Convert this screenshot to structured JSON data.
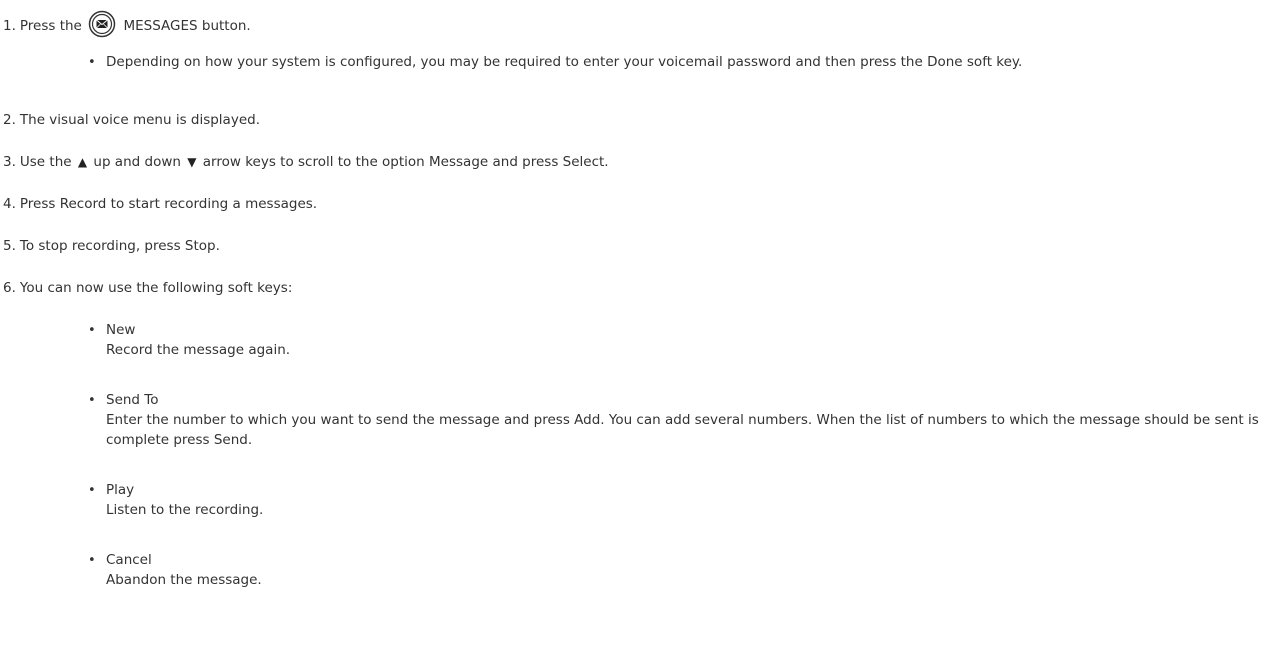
{
  "steps": [
    {
      "num": "1.",
      "before": "Press the",
      "after": "MESSAGES button."
    },
    {
      "num": "2.",
      "text": "The visual voice menu is displayed."
    },
    {
      "num": "3.",
      "before": "Use the",
      "mid": "up and down",
      "after": "arrow keys to scroll to the option Message and press Select."
    },
    {
      "num": "4.",
      "text": "Press Record to start recording a messages."
    },
    {
      "num": "5.",
      "text": "To stop recording, press Stop."
    },
    {
      "num": "6.",
      "text": "You can now use the following soft keys:"
    }
  ],
  "step1_note": "Depending on how your system is configured, you may be required to enter your voicemail password and then press the Done soft key.",
  "softkeys": [
    {
      "term": "New",
      "desc": "Record the message again."
    },
    {
      "term": "Send To",
      "desc": "Enter the number to which you want to send the message and press Add. You can add several numbers. When the list of numbers to which the message should be sent is complete press Send."
    },
    {
      "term": "Play",
      "desc": "Listen to the recording."
    },
    {
      "term": "Cancel",
      "desc": "Abandon the message."
    }
  ],
  "icons": {
    "messages": "envelope-button-icon",
    "up": "up-arrow-icon",
    "down": "down-arrow-icon"
  },
  "bullet_char": "•",
  "up_glyph": "▲",
  "down_glyph": "▼"
}
